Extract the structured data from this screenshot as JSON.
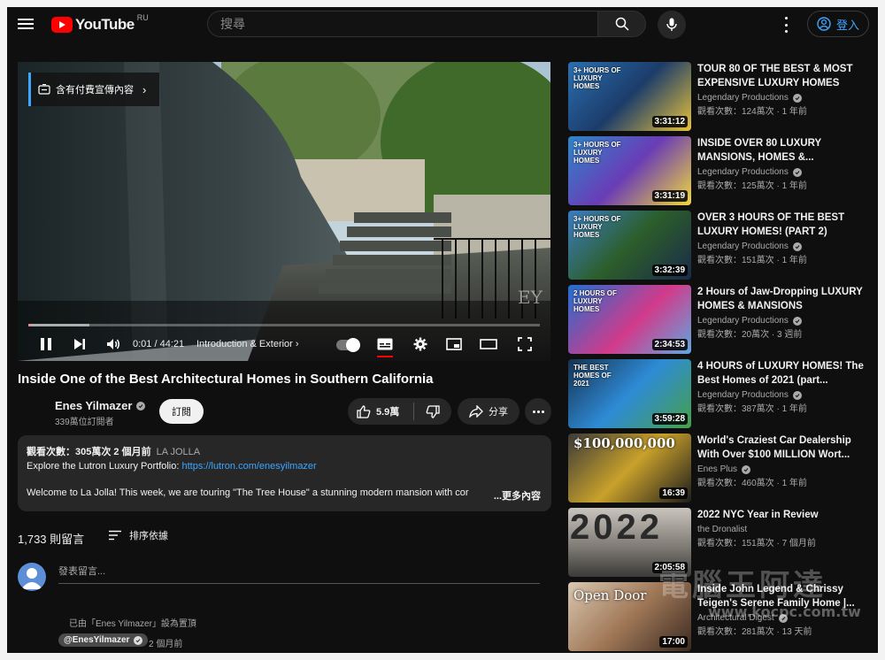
{
  "header": {
    "logo_text": "YouTube",
    "country": "RU",
    "search_placeholder": "搜尋",
    "signin_label": "登入"
  },
  "player": {
    "paid_promo_label": "含有付費宣傳內容",
    "time": "0:01 / 44:21",
    "chapter": "Introduction & Exterior",
    "progress_fraction": 0.004,
    "watermark": "EY"
  },
  "video": {
    "title": "Inside One of the Best Architectural Homes in Southern California",
    "channel": "Enes Yilmazer",
    "subscribers": "339萬位訂閱者",
    "subscribe_label": "訂閱",
    "likes": "5.9萬",
    "share_label": "分享"
  },
  "description": {
    "stats": "觀看次數：305萬次  2 個月前",
    "location": "LA JOLLA",
    "line2_prefix": "Explore the Lutron Luxury Portfolio: ",
    "link": "https://lutron.com/enesyilmazer",
    "line3": "Welcome to La Jolla! This week, we are touring \"The Tree House\" a stunning modern mansion with cor",
    "more_label": "...更多內容"
  },
  "comments": {
    "count": "1,733 則留言",
    "sort_label": "排序依據",
    "add_placeholder": "發表留言...",
    "pinned_by": "已由「Enes Yilmazer」設為置頂",
    "first_author": "@EnesYilmazer",
    "first_time": "2 個月前"
  },
  "recommendations": [
    {
      "title": "TOUR 80 OF THE BEST & MOST EXPENSIVE LUXURY HOMES",
      "channel": "Legendary Productions",
      "verified": true,
      "views": "觀看次數：124萬次 · 1 年前",
      "duration": "3:31:12",
      "thumb_text": "3+ HOURS OF LUXURY HOMES"
    },
    {
      "title": "INSIDE OVER 80 LUXURY MANSIONS, HOMES &...",
      "channel": "Legendary Productions",
      "verified": true,
      "views": "觀看次數：125萬次 · 1 年前",
      "duration": "3:31:19",
      "thumb_text": "3+ HOURS OF LUXURY HOMES"
    },
    {
      "title": "OVER 3 HOURS OF THE BEST LUXURY HOMES! (PART 2)",
      "channel": "Legendary Productions",
      "verified": true,
      "views": "觀看次數：151萬次 · 1 年前",
      "duration": "3:32:39",
      "thumb_text": "3+ HOURS OF LUXURY HOMES"
    },
    {
      "title": "2 Hours of Jaw-Dropping LUXURY HOMES & MANSIONS",
      "channel": "Legendary Productions",
      "verified": true,
      "views": "觀看次數：20萬次 · 3 週前",
      "duration": "2:34:53",
      "thumb_text": "2 HOURS OF LUXURY HOMES"
    },
    {
      "title": "4 HOURS of LUXURY HOMES! The Best Homes of 2021 (part...",
      "channel": "Legendary Productions",
      "verified": true,
      "views": "觀看次數：387萬次 · 1 年前",
      "duration": "3:59:28",
      "thumb_text": "THE BEST HOMES OF 2021"
    },
    {
      "title": "World's Craziest Car Dealership With Over $100 MILLION Wort...",
      "channel": "Enes Plus",
      "verified": true,
      "views": "觀看次數：460萬次 · 1 年前",
      "duration": "16:39",
      "thumb_text": "$100,000,000"
    },
    {
      "title": "2022 NYC Year in Review",
      "channel": "the Dronalist",
      "verified": false,
      "views": "觀看次數：151萬次 · 7 個月前",
      "duration": "2:05:58",
      "thumb_text": "2022"
    },
    {
      "title": "Inside John Legend & Chrissy Teigen's Serene Family Home |...",
      "channel": "Architectural Digest",
      "verified": true,
      "views": "觀看次數：281萬次 · 13 天前",
      "duration": "17:00",
      "thumb_text": "Open Door"
    }
  ],
  "site_watermark": {
    "zh": "電腦王阿達",
    "url": "www.kocpc.com.tw"
  }
}
